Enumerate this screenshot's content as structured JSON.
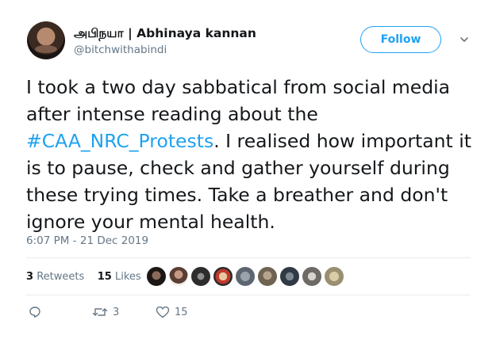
{
  "user": {
    "display_name": "அபிநயா | Abhinaya kannan",
    "handle": "@bitchwithabindi"
  },
  "follow_label": "Follow",
  "tweet": {
    "text_before": "I took a two day sabbatical from social media after intense reading about the ",
    "hashtag": "#CAA_NRC_Protests",
    "text_after": ". I realised how important it is to pause, check and gather yourself during these trying times. Take a breather and don't ignore your mental health."
  },
  "timestamp": "6:07 PM - 21 Dec 2019",
  "stats": {
    "retweets_count": "3",
    "retweets_label": "Retweets",
    "likes_count": "15",
    "likes_label": "Likes"
  },
  "actions": {
    "retweet_count": "3",
    "like_count": "15"
  },
  "colors": {
    "accent": "#1da1f2",
    "secondary_text": "#657786",
    "divider": "#e6ecf0"
  },
  "icons": [
    "caret-down-icon",
    "reply-icon",
    "retweet-icon",
    "like-icon"
  ]
}
